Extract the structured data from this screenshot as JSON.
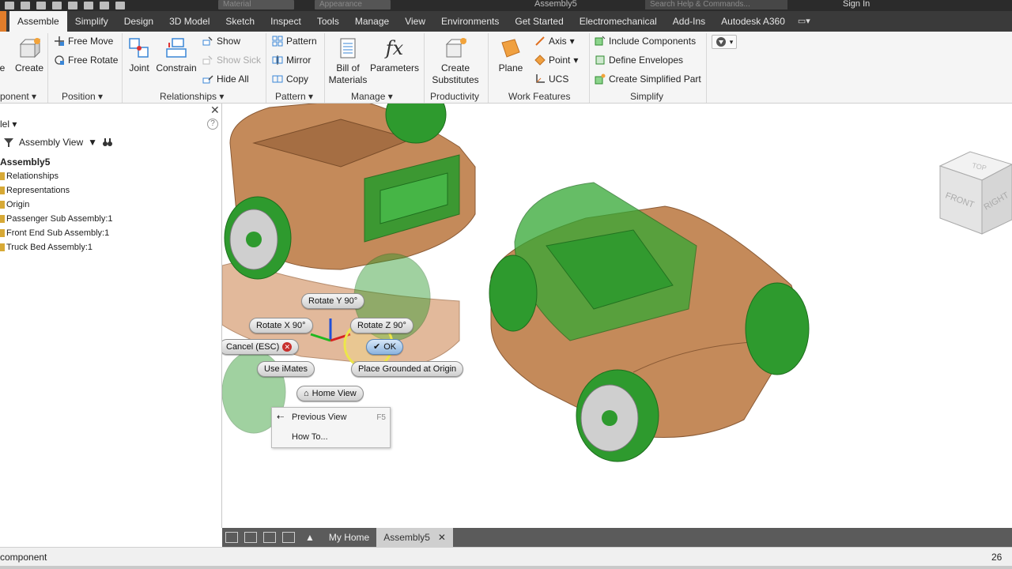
{
  "titlebar": {
    "material_placeholder": "Material",
    "appearance_placeholder": "Appearance",
    "document_title": "Assembly5",
    "search_placeholder": "Search Help & Commands...",
    "sign_in": "Sign In"
  },
  "tabs": [
    {
      "label": "Assemble",
      "active": true
    },
    {
      "label": "Simplify"
    },
    {
      "label": "Design"
    },
    {
      "label": "3D Model"
    },
    {
      "label": "Sketch"
    },
    {
      "label": "Inspect"
    },
    {
      "label": "Tools"
    },
    {
      "label": "Manage"
    },
    {
      "label": "View"
    },
    {
      "label": "Environments"
    },
    {
      "label": "Get Started"
    },
    {
      "label": "Electromechanical"
    },
    {
      "label": "Add-Ins"
    },
    {
      "label": "Autodesk A360"
    }
  ],
  "ribbon": {
    "component": {
      "place_label": "e",
      "create_label": "Create",
      "panel_label": "ponent"
    },
    "position": {
      "free_move": "Free Move",
      "free_rotate": "Free Rotate",
      "panel_label": "Position"
    },
    "relationships": {
      "joint": "Joint",
      "constrain": "Constrain",
      "show": "Show",
      "show_sick": "Show Sick",
      "hide_all": "Hide All",
      "panel_label": "Relationships"
    },
    "pattern": {
      "pattern": "Pattern",
      "mirror": "Mirror",
      "copy": "Copy",
      "panel_label": "Pattern"
    },
    "manage": {
      "bom_line1": "Bill of",
      "bom_line2": "Materials",
      "parameters": "Parameters",
      "fx_glyph": "fx",
      "panel_label": "Manage"
    },
    "productivity": {
      "line1": "Create",
      "line2": "Substitutes",
      "panel_label": "Productivity"
    },
    "work_features": {
      "plane": "Plane",
      "axis": "Axis",
      "point": "Point",
      "ucs": "UCS",
      "panel_label": "Work Features"
    },
    "simplify": {
      "include_components": "Include Components",
      "define_envelopes": "Define Envelopes",
      "create_simplified_part": "Create Simplified Part",
      "panel_label": "Simplify"
    }
  },
  "browser": {
    "header": "lel",
    "view_label": "Assembly View",
    "tree": [
      {
        "label": "Assembly5",
        "root": true
      },
      {
        "label": "Relationships"
      },
      {
        "label": "Representations"
      },
      {
        "label": "Origin"
      },
      {
        "label": "Passenger Sub Assembly:1"
      },
      {
        "label": "Front End Sub Assembly:1"
      },
      {
        "label": "Truck Bed Assembly:1"
      }
    ]
  },
  "marking_menu": {
    "rotate_y": "Rotate Y 90°",
    "rotate_x": "Rotate X 90°",
    "rotate_z": "Rotate Z 90°",
    "cancel": "Cancel (ESC)",
    "ok": "OK",
    "use_imates": "Use iMates",
    "place_grounded": "Place Grounded at Origin",
    "home_view": "Home View",
    "previous_view": "Previous View",
    "previous_view_shortcut": "F5",
    "how_to": "How To..."
  },
  "viewcube": {
    "top": "TOP",
    "front": "FRONT",
    "right": "RIGHT"
  },
  "doctabs": {
    "my_home": "My Home",
    "assembly": "Assembly5"
  },
  "status": {
    "message": "component",
    "count": "26"
  },
  "colors": {
    "wood": "#c48a5a",
    "green": "#2e9a2e",
    "ribbon_bg": "#f5f5f5",
    "tabbar_bg": "#3a3a3a"
  }
}
